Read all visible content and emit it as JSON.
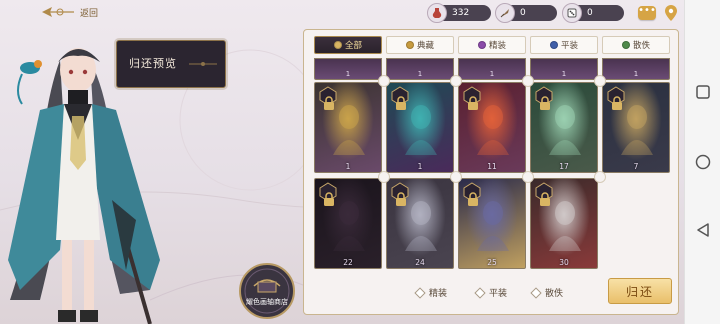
{
  "top_bar": {
    "back_label": "返回",
    "resources": [
      {
        "icon": "potion-icon",
        "value": "332"
      },
      {
        "icon": "quill-icon",
        "value": "0"
      },
      {
        "icon": "dice-icon",
        "value": "0"
      }
    ]
  },
  "preview": {
    "label": "归还预览"
  },
  "shop": {
    "label": "耀色画轴商店"
  },
  "tabs": [
    {
      "label": "全部",
      "active": true,
      "color": "#d9b563"
    },
    {
      "label": "典藏",
      "active": false,
      "color": "#c79b3f"
    },
    {
      "label": "精装",
      "active": false,
      "color": "#8a4aa8"
    },
    {
      "label": "平装",
      "active": false,
      "color": "#3f5fa8"
    },
    {
      "label": "散佚",
      "active": false,
      "color": "#4f8a4a"
    }
  ],
  "top_row_levels": [
    "1",
    "1",
    "1",
    "1",
    "1"
  ],
  "cards": [
    {
      "level": "1",
      "palette": [
        "#3a3330",
        "#c9a24a",
        "#6a4a6a"
      ]
    },
    {
      "level": "1",
      "palette": [
        "#1f4a55",
        "#3fb0b0",
        "#4a2a5a"
      ]
    },
    {
      "level": "11",
      "palette": [
        "#5a2030",
        "#e0603a",
        "#6a3a5a"
      ]
    },
    {
      "level": "17",
      "palette": [
        "#2a4a3a",
        "#9ad0b0",
        "#4a5a4a"
      ]
    },
    {
      "level": "7",
      "palette": [
        "#2a3040",
        "#c0a060",
        "#3a3a4a"
      ]
    },
    {
      "level": "22",
      "palette": [
        "#1a141c",
        "#3a2a3a",
        "#2a202a"
      ]
    },
    {
      "level": "24",
      "palette": [
        "#3a3440",
        "#b0b0c0",
        "#4a4450"
      ]
    },
    {
      "level": "25",
      "palette": [
        "#2a2a4a",
        "#6a6aa0",
        "#c0a060"
      ]
    },
    {
      "level": "30",
      "palette": [
        "#3a2a2a",
        "#d0c8c8",
        "#8a3a3a"
      ]
    }
  ],
  "legend": [
    {
      "label": "精装"
    },
    {
      "label": "平装"
    },
    {
      "label": "散佚"
    }
  ],
  "return_button": {
    "label": "归还"
  },
  "colors": {
    "accent_gold": "#e9bf6a",
    "dark_panel": "#2b2530",
    "pill_bg": "#4a4250"
  }
}
